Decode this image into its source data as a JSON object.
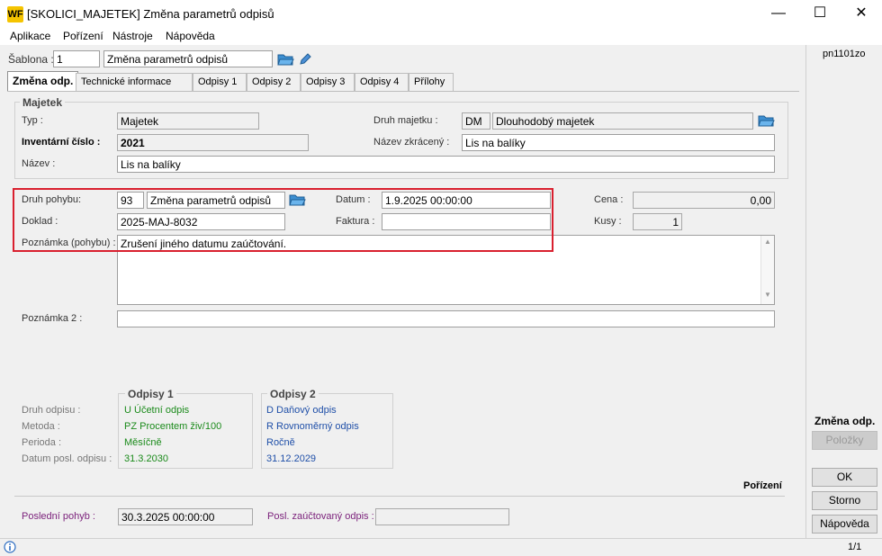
{
  "window": {
    "title": "[SKOLICI_MAJETEK] Změna parametrů odpisů",
    "logo": "WF",
    "minimize": "—",
    "maximize": "☐",
    "close": "✕"
  },
  "menu": [
    "Aplikace",
    "Pořízení",
    "Nástroje",
    "Nápověda"
  ],
  "template": {
    "label": "Šablona :",
    "number": "1",
    "name": "Změna parametrů odpisů"
  },
  "tabs": [
    "Změna odp.",
    "Technické informace",
    "Odpisy 1",
    "Odpisy 2",
    "Odpisy 3",
    "Odpisy 4",
    "Přílohy"
  ],
  "asset": {
    "group_title": "Majetek",
    "type_label": "Typ :",
    "type_value": "Majetek",
    "inv_label": "Inventární číslo :",
    "inv_value": "2021",
    "name_label": "Název :",
    "name_value": "Lis na balíky",
    "kind_label": "Druh majetku :",
    "kind_code": "DM",
    "kind_value": "Dlouhodobý majetek",
    "short_label": "Název zkrácený :",
    "short_value": "Lis na balíky"
  },
  "movement": {
    "type_label": "Druh pohybu:",
    "type_code": "93",
    "type_value": "Změna parametrů odpisů",
    "date_label": "Datum :",
    "date_value": "1.9.2025 00:00:00",
    "doc_label": "Doklad :",
    "doc_value": "2025-MAJ-8032",
    "invoice_label": "Faktura :",
    "invoice_value": "",
    "note_label": "Poznámka (pohybu) :",
    "note_value": "Zrušení jiného datumu zaúčtování.",
    "price_label": "Cena :",
    "price_value": "0,00",
    "qty_label": "Kusy :",
    "qty_value": "1",
    "note2_label": "Poznámka 2 :",
    "note2_value": ""
  },
  "depreciation": {
    "labels": [
      "Druh odpisu :",
      "Metoda :",
      "Perioda :",
      "Datum posl. odpisu :"
    ],
    "odpisy1": {
      "title": "Odpisy 1",
      "druh": "U  Účetní odpis",
      "metoda": "PZ  Procentem živ/100",
      "perioda": "Měsíčně",
      "datum": "31.3.2030"
    },
    "odpisy2": {
      "title": "Odpisy 2",
      "druh": "D  Daňový odpis",
      "metoda": "R  Rovnoměrný odpis",
      "perioda": "Ročně",
      "datum": "31.12.2029"
    }
  },
  "footer": {
    "last_move_label": "Poslední pohyb :",
    "last_move_value": "30.3.2025 00:00:00",
    "last_booked_label": "Posl. zaúčtovaný odpis :",
    "last_booked_value": "",
    "state": "Pořízení"
  },
  "right": {
    "code": "pn1101zo",
    "section": "Změna odp.",
    "items_btn": "Položky",
    "ok_btn": "OK",
    "cancel_btn": "Storno",
    "help_btn": "Nápověda"
  },
  "status": {
    "page": "1/1"
  },
  "colors": {
    "highlight_border": "#d9202f",
    "odpisy1_text": "#1a8a1a",
    "odpisy2_text": "#1f4fa8",
    "footer_label": "#7a1f7a"
  }
}
